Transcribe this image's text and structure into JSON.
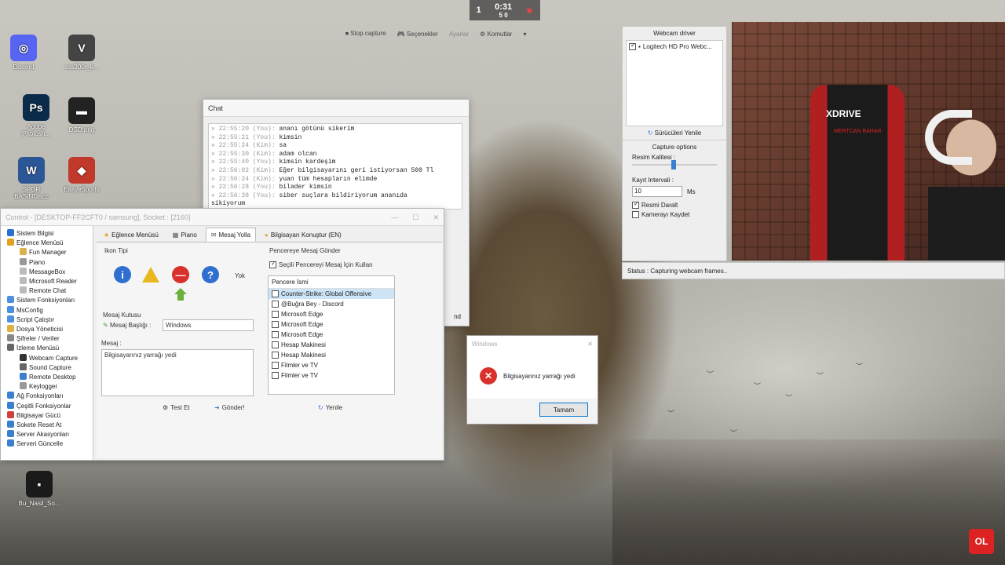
{
  "top_overlay": {
    "score_left": "1",
    "timer": "0:31",
    "score_sub": "5   0",
    "buttons": [
      "Stop capture",
      "Seçenekler",
      "Ayarlar",
      "Komutlar"
    ]
  },
  "desktop_icons": [
    {
      "label": "Discord",
      "icon": "discord-icon",
      "color": "#5865f2",
      "glyph": "◎"
    },
    {
      "label": "sss300r_k...",
      "icon": "app-icon",
      "color": "#444444",
      "glyph": "V"
    },
    {
      "label": "Adobe Photosh...",
      "icon": "photoshop-icon",
      "color": "#0b2b4a",
      "glyph": "Ps"
    },
    {
      "label": "DSD.png",
      "icon": "image-icon",
      "color": "#222222",
      "glyph": "▬"
    },
    {
      "label": "SPOR BASINDiscc",
      "icon": "word-icon",
      "color": "#2b5797",
      "glyph": "W"
    },
    {
      "label": "EasyeSports",
      "icon": "easyesports-icon",
      "color": "#c0392b",
      "glyph": "◆"
    },
    {
      "label": "Bu_Nasil_So...",
      "icon": "video-icon",
      "color": "#1a1a1a",
      "glyph": "▪"
    }
  ],
  "chat": {
    "title": "Chat",
    "lines": [
      {
        "ts": "» 22:55:20 (You):",
        "text": "ananı götünü sikerim"
      },
      {
        "ts": "» 22:55:21 (You):",
        "text": "kimsin"
      },
      {
        "ts": "» 22:55:24 (Kim):",
        "text": "sa"
      },
      {
        "ts": "» 22:55:30 (Kim):",
        "text": "adam olcan"
      },
      {
        "ts": "» 22:55:40 (You):",
        "text": "kimsin kardeşim"
      },
      {
        "ts": "» 22:56:02 (Kim):",
        "text": "Eğer bilgisayarını geri istiyorsan 500 Tl"
      },
      {
        "ts": "» 22:56:24 (Kim):",
        "text": "yuan tüm hesapların elimde"
      },
      {
        "ts": "» 22:56:28 (You):",
        "text": "bilader kimsin"
      },
      {
        "ts": "» 22:56:38 (You):",
        "text": "siber suçlara bildiriyorum ananıda"
      },
      {
        "ts": "",
        "text": "sikiyorum"
      }
    ],
    "side_label": "nd"
  },
  "control": {
    "title": "Control - [DESKTOP-FF2CFT0 / samsung], Socket : [2160]",
    "tree": [
      {
        "label": "Sistem Bilgisi",
        "child": false,
        "color": "#2a6fd6"
      },
      {
        "label": "Eğlence Menüsü",
        "child": false,
        "color": "#e0a020"
      },
      {
        "label": "Fun Manager",
        "child": true,
        "color": "#d9b34a"
      },
      {
        "label": "Piano",
        "child": true,
        "color": "#999999"
      },
      {
        "label": "MessageBox",
        "child": true,
        "color": "#bbbbbb"
      },
      {
        "label": "Microsoft Reader",
        "child": true,
        "color": "#bbbbbb"
      },
      {
        "label": "Remote Chat",
        "child": true,
        "color": "#bbbbbb"
      },
      {
        "label": "Sistem Fonksiyonları",
        "child": false,
        "color": "#4a8fe0"
      },
      {
        "label": "MsConfig",
        "child": false,
        "color": "#4a8fe0"
      },
      {
        "label": "Script Çalıştır",
        "child": false,
        "color": "#4a8fe0"
      },
      {
        "label": "Dosya Yöneticisi",
        "child": false,
        "color": "#e0b040"
      },
      {
        "label": "Şifreler / Veriler",
        "child": false,
        "color": "#888888"
      },
      {
        "label": "İzleme Menüsü",
        "child": false,
        "color": "#666666"
      },
      {
        "label": "Webcam Capture",
        "child": true,
        "color": "#333333"
      },
      {
        "label": "Sound Capture",
        "child": true,
        "color": "#666666"
      },
      {
        "label": "Remote Desktop",
        "child": true,
        "color": "#3a7fd0"
      },
      {
        "label": "Keylogger",
        "child": true,
        "color": "#999999"
      },
      {
        "label": "Ağ Fonksiyonları",
        "child": false,
        "color": "#3a7fd0"
      },
      {
        "label": "Çeşitli Fonksiyonlar",
        "child": false,
        "color": "#3a7fd0"
      },
      {
        "label": "Bilgisayar Gücü",
        "child": false,
        "color": "#d04040"
      },
      {
        "label": "Sokete Reset At",
        "child": false,
        "color": "#3a7fd0"
      },
      {
        "label": "Server Akasyonları",
        "child": false,
        "color": "#3a7fd0"
      },
      {
        "label": "Serveri Güncelle",
        "child": false,
        "color": "#3a7fd0"
      }
    ],
    "tabs": [
      "Eğlence Menüsü",
      "Piano",
      "Mesaj Yolla",
      "Bilgisayarı Konuştur (EN)"
    ],
    "active_tab": 2,
    "icon_type_label": "Ikon Tipi",
    "icon_none_label": "Yok",
    "message_box_label": "Mesaj Kutusu",
    "title_label": "Mesaj Başlığı :",
    "title_value": "Windows",
    "message_label": "Mesaj :",
    "message_value": "Bilgisayarınız yarrağı yedi",
    "test_button": "Test Et",
    "send_button": "Gönder!",
    "window_group_label": "Pencereye Mesaj Gönder",
    "use_selected_label": "Seçili Pencereyi Mesaj İçin Kullan",
    "window_list_header": "Pencere İsmi",
    "windows": [
      "Counter-Strike: Global Offensive",
      "@Buğra Bey - Discord",
      "Microsoft Edge",
      "Microsoft Edge",
      "Microsoft Edge",
      "Hesap Makinesi",
      "Hesap Makinesi",
      "Filmler ve TV",
      "Filmler ve TV"
    ],
    "refresh_button": "Yenile"
  },
  "msgbox": {
    "title": "Windows",
    "text": "Bilgisayarınız yarrağı yedi",
    "ok": "Tamam"
  },
  "webcam": {
    "driver_label": "Webcam driver",
    "device": "Logitech HD Pro Webc...",
    "refresh_drivers": "Sürücüleri Yenile",
    "capture_options": "Capture options",
    "quality_label": "Resim Kalitesi :",
    "interval_label": "Kayıt Intervali :",
    "interval_value": "10",
    "interval_unit": "Ms",
    "shrink_label": "Resmi Daralt",
    "save_label": "Kamerayı Kaydet",
    "status": "Status : Capturing webcam frames..",
    "chair_brand": "XDRIVE",
    "chair_text": "MERTCAN BAHAR"
  },
  "watermark": "OL"
}
